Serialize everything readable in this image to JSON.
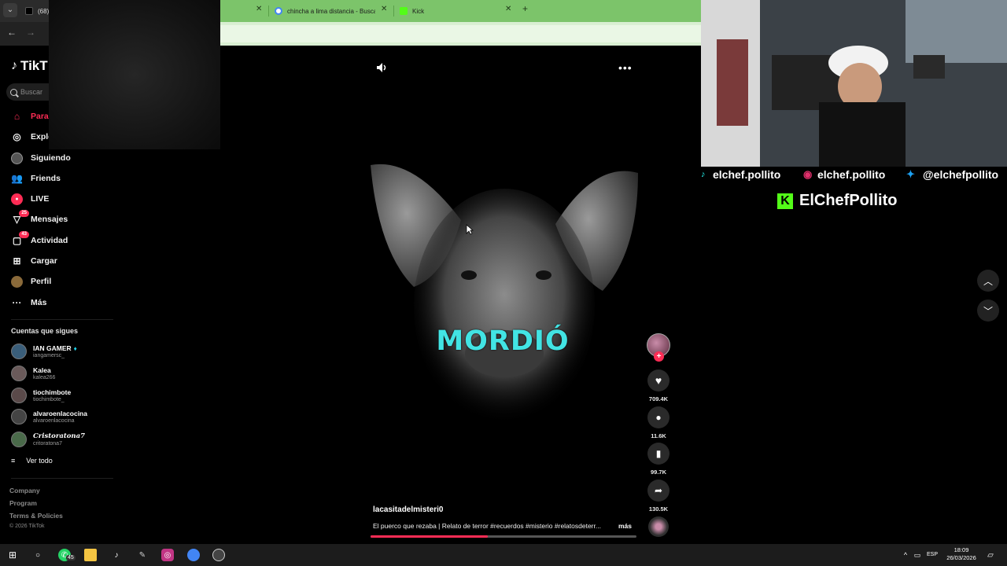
{
  "browser": {
    "tabs": [
      {
        "label": "(68)"
      },
      {
        "label": "chincha a lima distancia - Buscar"
      },
      {
        "label": "Kick"
      }
    ]
  },
  "tiktok": {
    "logo": "TikT",
    "search_placeholder": "Buscar",
    "nav": [
      {
        "label": "Para",
        "icon": "home-icon",
        "active": true
      },
      {
        "label": "Explo",
        "icon": "compass-icon"
      },
      {
        "label": "Siguiendo",
        "icon": "following-icon"
      },
      {
        "label": "Friends",
        "icon": "friends-icon"
      },
      {
        "label": "LIVE",
        "icon": "live-icon"
      },
      {
        "label": "Mensajes",
        "icon": "messages-icon",
        "badge": "25"
      },
      {
        "label": "Actividad",
        "icon": "activity-icon",
        "badge": "43"
      },
      {
        "label": "Cargar",
        "icon": "upload-icon"
      },
      {
        "label": "Perfil",
        "icon": "profile-icon"
      },
      {
        "label": "Más",
        "icon": "more-icon"
      }
    ],
    "following_heading": "Cuentas que sigues",
    "accounts": [
      {
        "name": "IAN GAMER",
        "handle": "iangamersc_",
        "verified": true
      },
      {
        "name": "Kalea",
        "handle": "kalea266"
      },
      {
        "name": "tiochimbote",
        "handle": "tiochimbote_"
      },
      {
        "name": "alvaroenlacocina",
        "handle": "alvaroenlacocina"
      },
      {
        "name": "Cristoratona7",
        "handle": "critoratona7"
      }
    ],
    "see_all": "Ver todo",
    "footer": [
      "Company",
      "Program",
      "Terms & Policies"
    ],
    "copyright": "© 2026 TikTok"
  },
  "video": {
    "overlay_text": "MORDIÓ",
    "author": "lacasitadelmisteri0",
    "description": "El puerco que rezaba | Relato de terror #recuerdos #misterio #relatosdeterr...",
    "more": "más",
    "likes": "709.4K",
    "comments": "11.6K",
    "saves": "99.7K",
    "shares": "130.5K",
    "progress": 0.44
  },
  "stream": {
    "tiktok_handle": "elchef.pollito",
    "instagram_handle": "elchef.pollito",
    "twitter_handle": "@elchefpollito",
    "kick_name": "ElChefPollito"
  },
  "taskbar": {
    "whatsapp_badge": "45",
    "language": "ESP",
    "time": "18:09",
    "date": "26/03/2026"
  },
  "colors": {
    "tiktok_red": "#fe2c55",
    "overlay_cyan": "#42e4e4",
    "kick_green": "#53fc18",
    "tab_green": "#7cc46a"
  }
}
